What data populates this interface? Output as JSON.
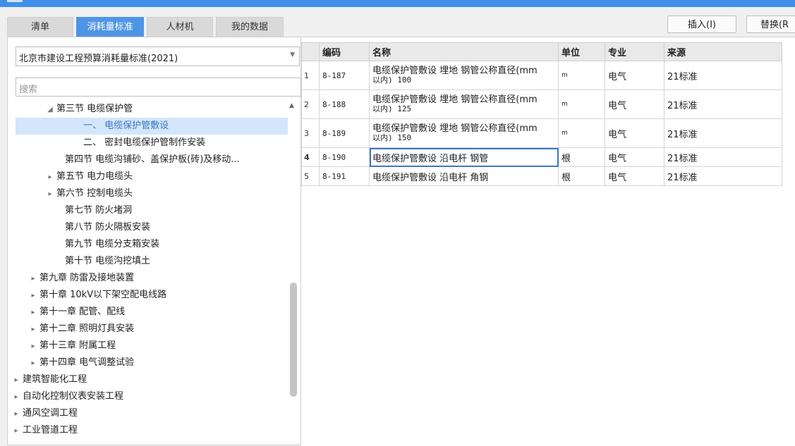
{
  "tabs": [
    "清单",
    "消耗量标准",
    "人材机",
    "我的数据"
  ],
  "active_tab": 1,
  "library_select": "北京市建设工程预算消耗量标准(2021)",
  "search_placeholder": "搜索",
  "toolbar": {
    "insert": "插入(I)",
    "replace": "替换(R"
  },
  "tree": [
    {
      "label": "第三节 电缆保护管",
      "expander": "expanded"
    },
    {
      "label": "一、 电缆保护管敷设",
      "selected": true
    },
    {
      "label": "二、 密封电缆保护管制作安装"
    },
    {
      "label": "第四节 电缆沟铺砂、盖保护板(砖)及移动..."
    },
    {
      "label": "第五节 电力电缆头",
      "expander": "collapsed"
    },
    {
      "label": "第六节 控制电缆头",
      "expander": "collapsed"
    },
    {
      "label": "第七节 防火堵洞"
    },
    {
      "label": "第八节 防火隔板安装"
    },
    {
      "label": "第九节 电缆分支箱安装"
    },
    {
      "label": "第十节 电缆沟挖填土"
    },
    {
      "label": "第九章 防雷及接地装置",
      "expander": "collapsed"
    },
    {
      "label": "第十章 10kV以下架空配电线路",
      "expander": "collapsed"
    },
    {
      "label": "第十一章 配管、配线",
      "expander": "collapsed"
    },
    {
      "label": "第十二章 照明灯具安装",
      "expander": "collapsed"
    },
    {
      "label": "第十三章 附属工程",
      "expander": "collapsed"
    },
    {
      "label": "第十四章 电气调整试验",
      "expander": "collapsed"
    },
    {
      "label": "建筑智能化工程",
      "expander": "collapsed"
    },
    {
      "label": "自动化控制仪表安装工程",
      "expander": "collapsed"
    },
    {
      "label": "通风空调工程",
      "expander": "collapsed"
    },
    {
      "label": "工业管道工程",
      "expander": "collapsed"
    }
  ],
  "table": {
    "columns": [
      "编码",
      "名称",
      "单位",
      "专业",
      "来源"
    ],
    "rows": [
      {
        "idx": "1",
        "code": "8-187",
        "name_line1": "电缆保护管敷设 埋地 钢管公称直径(mm",
        "name_line2": "以内) 100",
        "unit": "m",
        "major": "电气",
        "source": "21标准"
      },
      {
        "idx": "2",
        "code": "8-188",
        "name_line1": "电缆保护管敷设 埋地 钢管公称直径(mm",
        "name_line2": "以内) 125",
        "unit": "m",
        "major": "电气",
        "source": "21标准"
      },
      {
        "idx": "3",
        "code": "8-189",
        "name_line1": "电缆保护管敷设 埋地 钢管公称直径(mm",
        "name_line2": "以内) 150",
        "unit": "m",
        "major": "电气",
        "source": "21标准"
      },
      {
        "idx": "4",
        "code": "8-190",
        "name": "电缆保护管敷设 沿电杆 钢管",
        "unit": "根",
        "major": "电气",
        "source": "21标准",
        "active": true
      },
      {
        "idx": "5",
        "code": "8-191",
        "name": "电缆保护管敷设 沿电杆 角钢",
        "unit": "根",
        "major": "电气",
        "source": "21标准"
      }
    ]
  }
}
